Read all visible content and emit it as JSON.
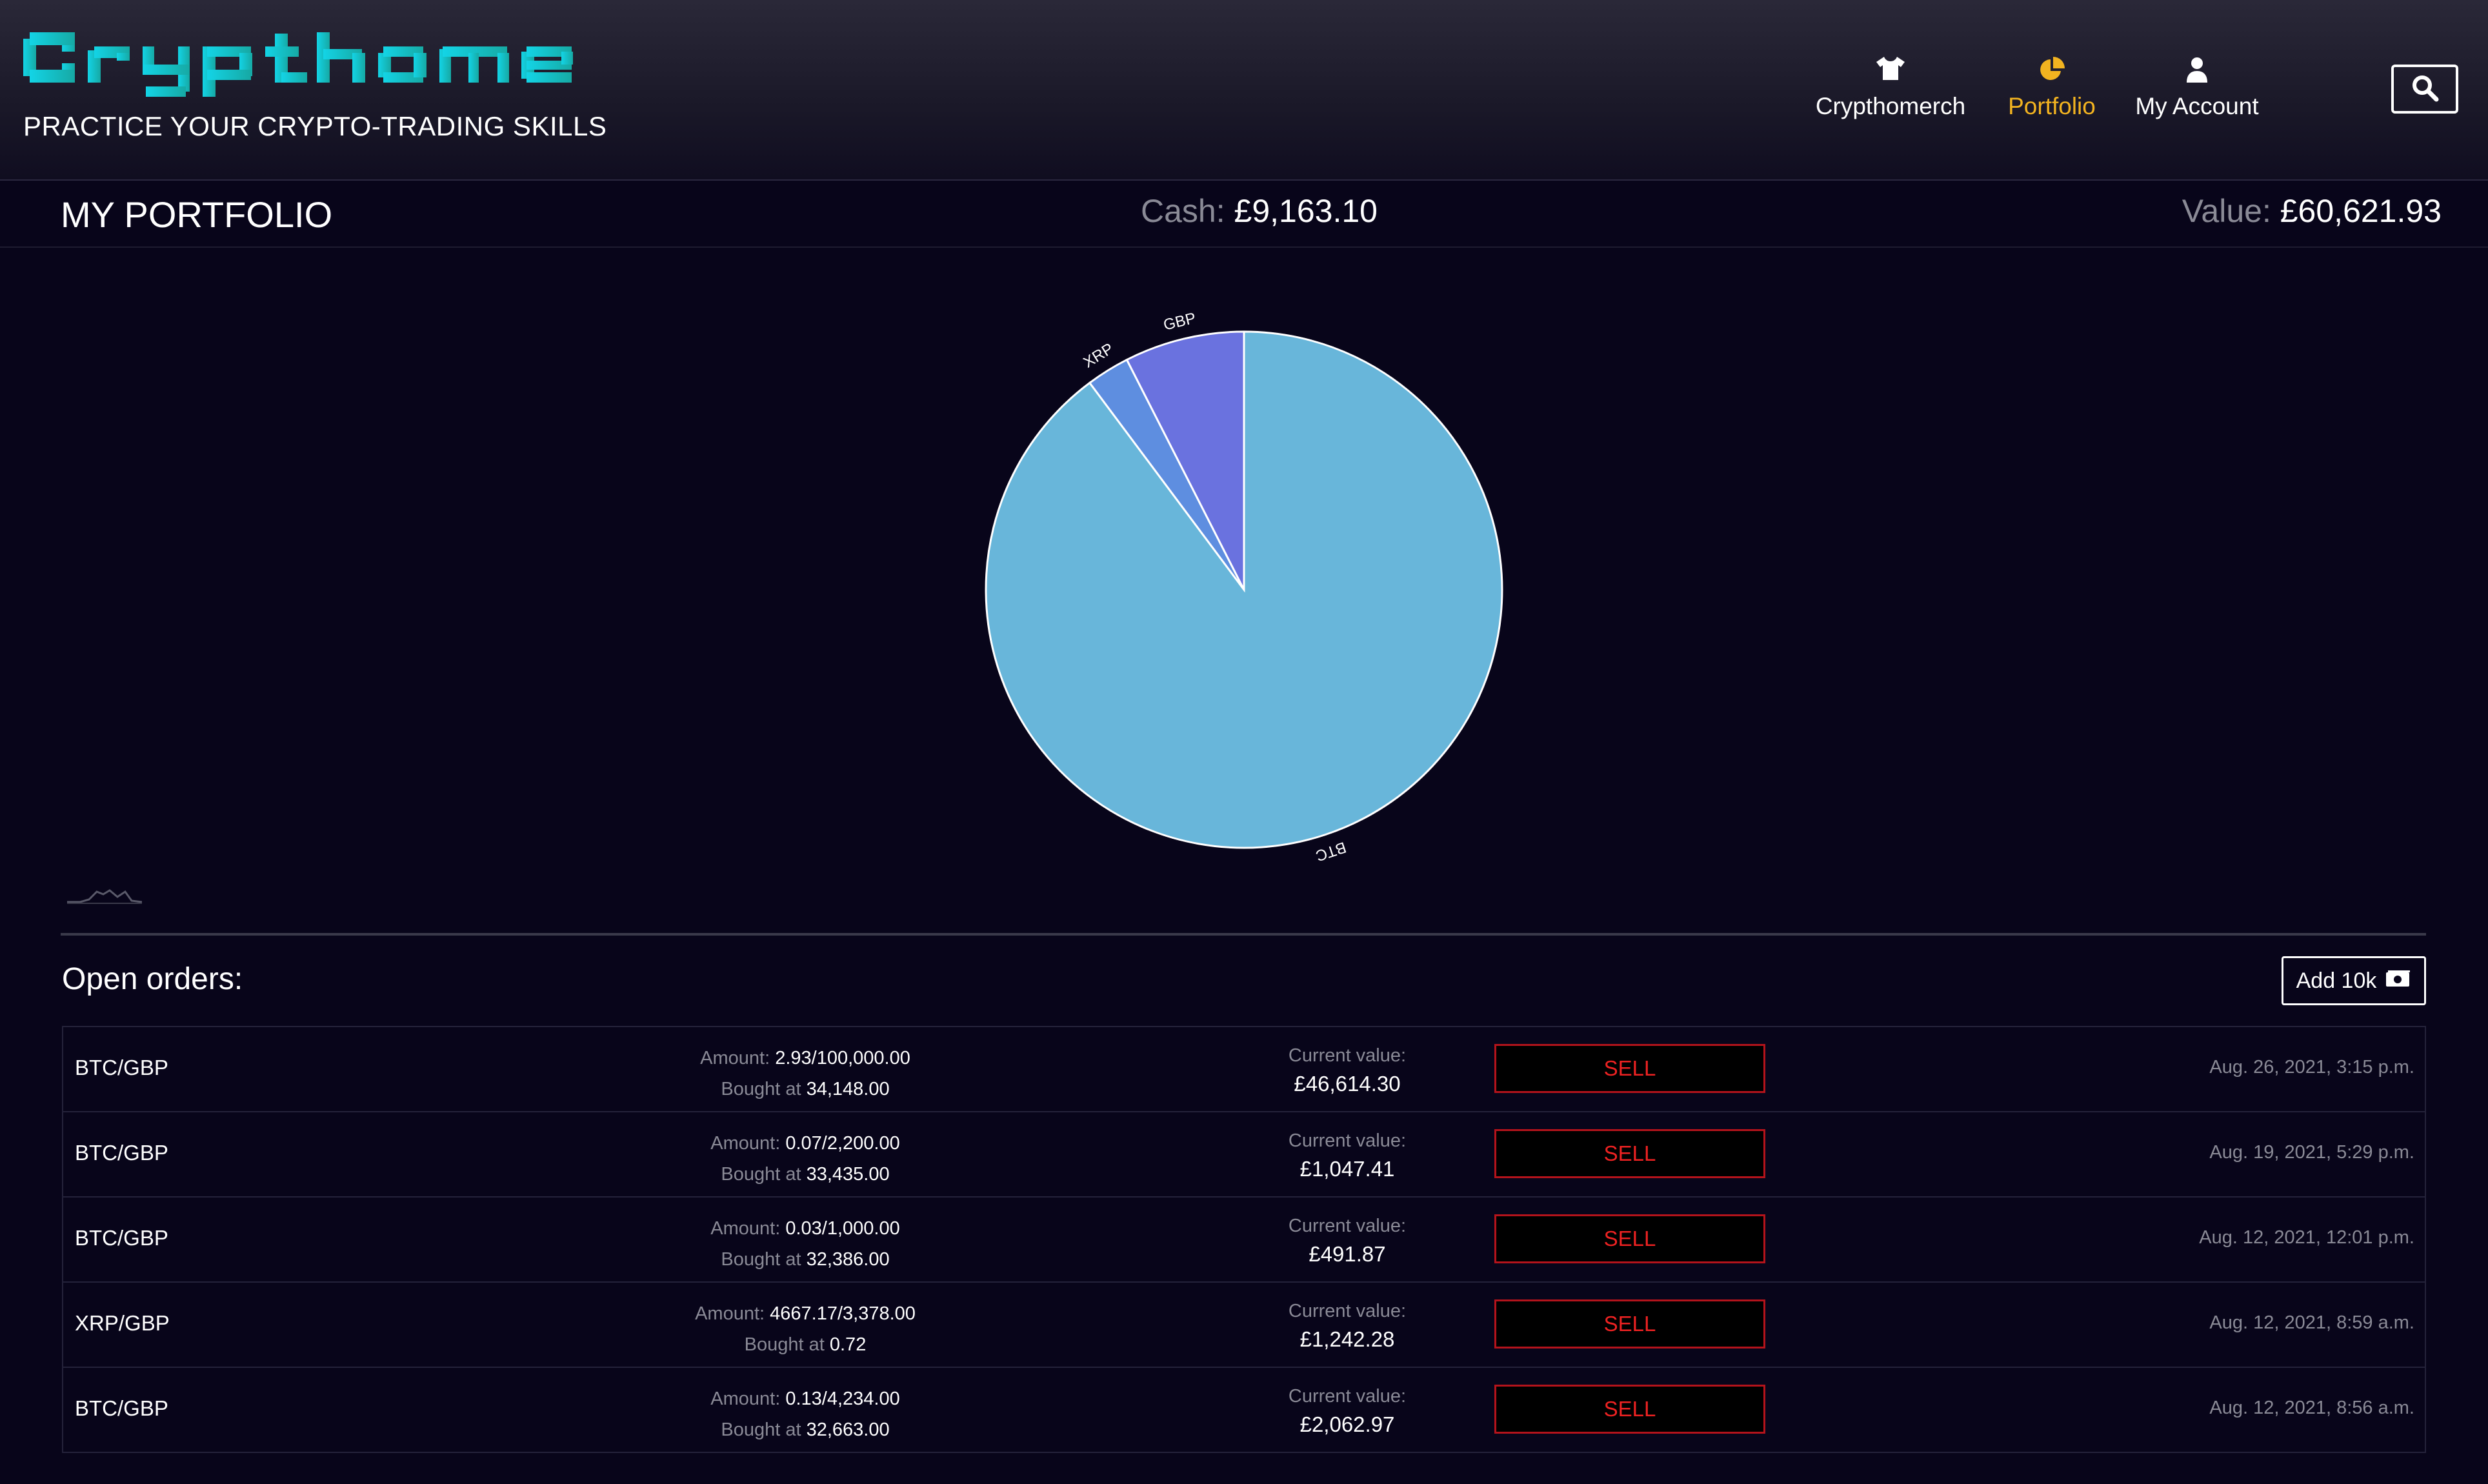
{
  "header": {
    "logo_text": "Crypthome",
    "tagline": "PRACTICE YOUR CRYPTO-TRADING SKILLS",
    "nav": [
      {
        "label": "Crypthomerch",
        "icon": "tshirt-icon"
      },
      {
        "label": "Portfolio",
        "icon": "pie-chart-icon",
        "active": true
      },
      {
        "label": "My Account",
        "icon": "user-icon"
      }
    ],
    "search_icon": "search-icon"
  },
  "portfolio": {
    "title": "MY PORTFOLIO",
    "cash_label": "Cash:",
    "cash_value": "£9,163.10",
    "value_label": "Value:",
    "value_value": "£60,621.93"
  },
  "chart_data": {
    "type": "pie",
    "title": "",
    "slices": [
      {
        "label": "BTC",
        "value": 89.8,
        "color": "#68b6da"
      },
      {
        "label": "XRP",
        "value": 2.7,
        "color": "#5e8ee0"
      },
      {
        "label": "GBP",
        "value": 7.5,
        "color": "#6a72df"
      }
    ]
  },
  "orders_section": {
    "title": "Open orders:",
    "add_button_label": "Add 10k",
    "add_button_icon": "money-icon",
    "amount_label": "Amount:",
    "bought_label": "Bought at",
    "current_label": "Current value:",
    "sell_label": "SELL",
    "rows": [
      {
        "pair": "BTC/GBP",
        "amount": "2.93/100,000.00",
        "bought_at": "34,148.00",
        "current_value": "£46,614.30",
        "date": "Aug. 26, 2021, 3:15 p.m."
      },
      {
        "pair": "BTC/GBP",
        "amount": "0.07/2,200.00",
        "bought_at": "33,435.00",
        "current_value": "£1,047.41",
        "date": "Aug. 19, 2021, 5:29 p.m."
      },
      {
        "pair": "BTC/GBP",
        "amount": "0.03/1,000.00",
        "bought_at": "32,386.00",
        "current_value": "£491.87",
        "date": "Aug. 12, 2021, 12:01 p.m."
      },
      {
        "pair": "XRP/GBP",
        "amount": "4667.17/3,378.00",
        "bought_at": "0.72",
        "current_value": "£1,242.28",
        "date": "Aug. 12, 2021, 8:59 a.m."
      },
      {
        "pair": "BTC/GBP",
        "amount": "0.13/4,234.00",
        "bought_at": "32,663.00",
        "current_value": "£2,062.97",
        "date": "Aug. 12, 2021, 8:56 a.m."
      }
    ]
  },
  "colors": {
    "background": "#08051a",
    "accent_active": "#f2b320",
    "logo": "#17c4d8",
    "sell_red": "#ee2222"
  }
}
